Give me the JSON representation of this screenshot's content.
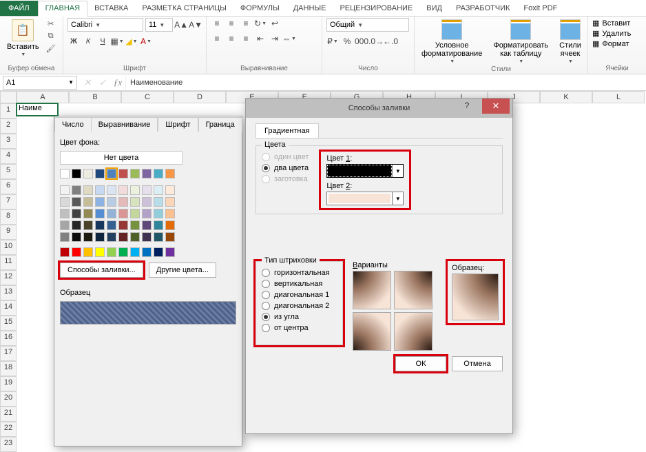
{
  "tabs": {
    "file": "ФАЙЛ",
    "home": "ГЛАВНАЯ",
    "insert": "ВСТАВКА",
    "layout": "РАЗМЕТКА СТРАНИЦЫ",
    "formulas": "ФОРМУЛЫ",
    "data": "ДАННЫЕ",
    "review": "РЕЦЕНЗИРОВАНИЕ",
    "view": "ВИД",
    "developer": "РАЗРАБОТЧИК",
    "foxit": "Foxit PDF"
  },
  "ribbon": {
    "clipboard": {
      "label": "Буфер обмена",
      "paste": "Вставить"
    },
    "font": {
      "label": "Шрифт",
      "name": "Calibri",
      "size": "11",
      "b": "Ж",
      "i": "К",
      "u": "Ч"
    },
    "alignment": {
      "label": "Выравнивание"
    },
    "number": {
      "label": "Число",
      "format": "Общий"
    },
    "styles": {
      "label": "Стили",
      "cond": "Условное форматирование",
      "table": "Форматировать как таблицу",
      "cell": "Стили ячеек"
    },
    "cells": {
      "label": "Ячейки",
      "insert": "Вставит",
      "delete": "Удалить",
      "format": "Формат"
    }
  },
  "namebox": "A1",
  "formula": "Наименование",
  "cell_a1": "Наиме",
  "row_numbers": [
    "1",
    "2",
    "3",
    "4",
    "5",
    "6",
    "7",
    "8",
    "9",
    "10",
    "11",
    "12",
    "13",
    "14",
    "15",
    "16",
    "17",
    "18",
    "19",
    "20",
    "21",
    "22",
    "23"
  ],
  "col_letters": [
    "A",
    "B",
    "C",
    "D",
    "E",
    "F",
    "G",
    "H",
    "I",
    "J",
    "K",
    "L"
  ],
  "dlg1": {
    "tabs": {
      "number": "Число",
      "alignment": "Выравнивание",
      "font": "Шрифт",
      "border": "Граница"
    },
    "bgcolor": "Цвет фона:",
    "nocolor": "Нет цвета",
    "fillways": "Способы заливки...",
    "othercolors": "Другие цвета...",
    "sample": "Образец"
  },
  "dlg2": {
    "title": "Способы заливки",
    "tab_gradient": "Градиентная",
    "colors_legend": "Цвета",
    "one": "один цвет",
    "two": "два цвета",
    "preset": "заготовка",
    "color1": "Цвет 1:",
    "color2": "Цвет 2:",
    "hatch_legend": "Тип штриховки",
    "horiz": "горизонтальная",
    "vert": "вертикальная",
    "diag1": "диагональная 1",
    "diag2": "диагональная 2",
    "corner": "из угла",
    "center": "от центра",
    "variants": "Варианты",
    "sample": "Образец:",
    "ok": "ОК",
    "cancel": "Отмена"
  },
  "palette_theme": [
    [
      "#ffffff",
      "#000000",
      "#eeece1",
      "#1f497d",
      "#4f81bd",
      "#c0504d",
      "#9bbb59",
      "#8064a2",
      "#4bacc6",
      "#f79646"
    ],
    [
      "#f2f2f2",
      "#808080",
      "#ddd9c3",
      "#c6d9f0",
      "#dbe5f1",
      "#f2dcdb",
      "#ebf1dd",
      "#e5e0ec",
      "#dbeef3",
      "#fdeada"
    ],
    [
      "#d9d9d9",
      "#595959",
      "#c4bd97",
      "#8db3e2",
      "#b8cce4",
      "#e5b9b7",
      "#d7e3bc",
      "#ccc1d9",
      "#b7dde8",
      "#fbd5b5"
    ],
    [
      "#bfbfbf",
      "#404040",
      "#938953",
      "#548dd4",
      "#95b3d7",
      "#d99694",
      "#c3d69b",
      "#b2a2c7",
      "#92cddc",
      "#fac08f"
    ],
    [
      "#a6a6a6",
      "#262626",
      "#494429",
      "#17365d",
      "#366092",
      "#953734",
      "#76923c",
      "#5f497a",
      "#31859b",
      "#e36c09"
    ],
    [
      "#808080",
      "#0d0d0d",
      "#1d1b10",
      "#0f243e",
      "#244061",
      "#632423",
      "#4f6128",
      "#3f3151",
      "#205867",
      "#974806"
    ]
  ],
  "palette_std": [
    "#c00000",
    "#ff0000",
    "#ffc000",
    "#ffff00",
    "#92d050",
    "#00b050",
    "#00b0f0",
    "#0070c0",
    "#002060",
    "#7030a0"
  ]
}
